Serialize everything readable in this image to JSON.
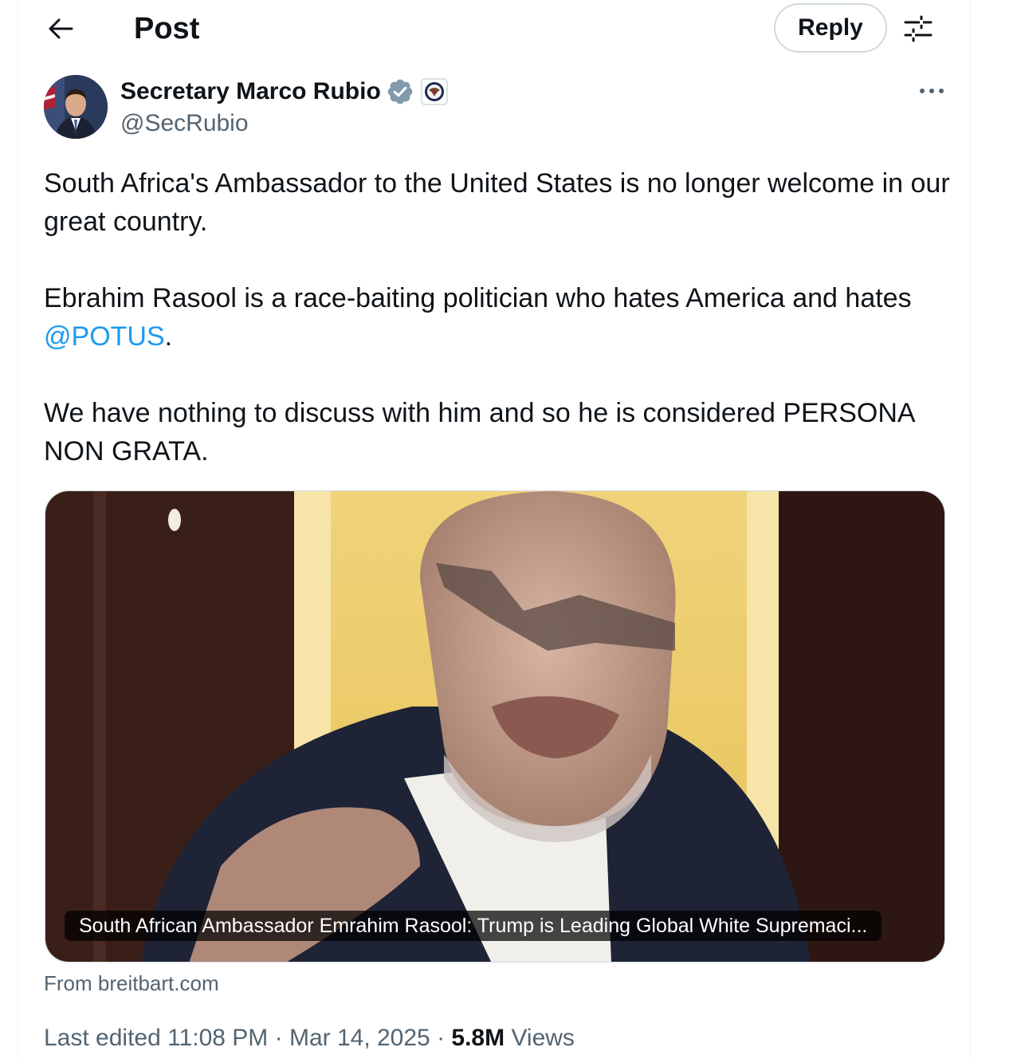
{
  "header": {
    "title": "Post",
    "reply_label": "Reply",
    "icons": [
      "back-arrow-icon",
      "sliders-icon"
    ]
  },
  "author": {
    "name": "Secretary Marco Rubio",
    "handle": "@SecRubio",
    "verified_badge": "verified-badge-icon",
    "affiliation_badge": "state-department-seal-icon"
  },
  "tweet": {
    "para1": "South Africa's Ambassador to the United States is no longer welcome in our great country.",
    "para2_before": "Ebrahim Rasool is a race-baiting politician who hates America and hates ",
    "mention": "@POTUS",
    "para2_after": ".",
    "para3": "We have nothing to discuss with him and so he is considered PERSONA NON GRATA."
  },
  "media": {
    "caption": "South African Ambassador Emrahim Rasool: Trump is Leading Global White Supremaci...",
    "source": "From breitbart.com"
  },
  "meta": {
    "edited": "Last edited 11:08 PM · Mar 14, 2025 · ",
    "views_count": "5.8M",
    "views_label": " Views"
  },
  "colors": {
    "accent": "#1d9bf0",
    "text": "#0f1419",
    "secondary": "#536471",
    "border": "#cfd9de"
  }
}
